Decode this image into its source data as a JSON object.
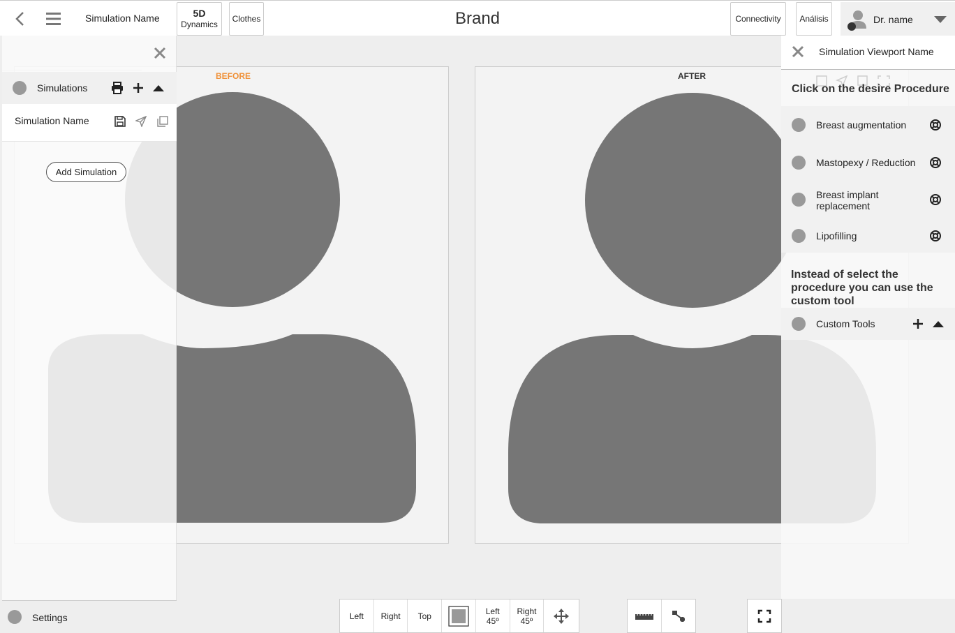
{
  "topbar": {
    "simulation_name": "Simulation Name",
    "btn_5d_line1": "5D",
    "btn_5d_line2": "Dynamics",
    "btn_clothes": "Clothes",
    "brand": "Brand",
    "btn_connectivity": "Connectivity",
    "btn_analisis": "Análisis",
    "user_name": "Dr. name"
  },
  "viewports": {
    "before_label": "BEFORE",
    "after_label": "AFTER"
  },
  "left_panel": {
    "search_placeholder": "",
    "section_title": "Simulations",
    "simulation_item": "Simulation Name",
    "add_button": "Add Simulation",
    "settings_label": "Settings"
  },
  "right_panel": {
    "title": "Simulation Viewport Name",
    "instruction": "Click on the desire Procedure",
    "procedures": [
      "Breast augmentation",
      "Mastopexy / Reduction",
      "Breast implant replacement",
      "Lipofilling"
    ],
    "instruction2": "Instead of select the procedure you can use the custom tool",
    "custom_tools": "Custom Tools"
  },
  "bottom_toolbar": {
    "view_left": "Left",
    "view_right": "Right",
    "view_top": "Top",
    "left45_line1": "Left",
    "left45_line2": "45º",
    "right45_line1": "Right",
    "right45_line2": "45º"
  },
  "colors": {
    "before_label": "#f0923a",
    "avatar": "#767676",
    "avatar_faded": "#e8e8e8",
    "dot": "#999999"
  },
  "icons": [
    "back-icon",
    "menu-icon",
    "user-icon",
    "chevron-down-icon",
    "close-icon",
    "print-icon",
    "plus-icon",
    "caret-up-icon",
    "save-icon",
    "send-icon",
    "copy-icon",
    "lifebuoy-icon",
    "move-icon",
    "ruler-icon",
    "link-icon",
    "fullscreen-icon"
  ]
}
